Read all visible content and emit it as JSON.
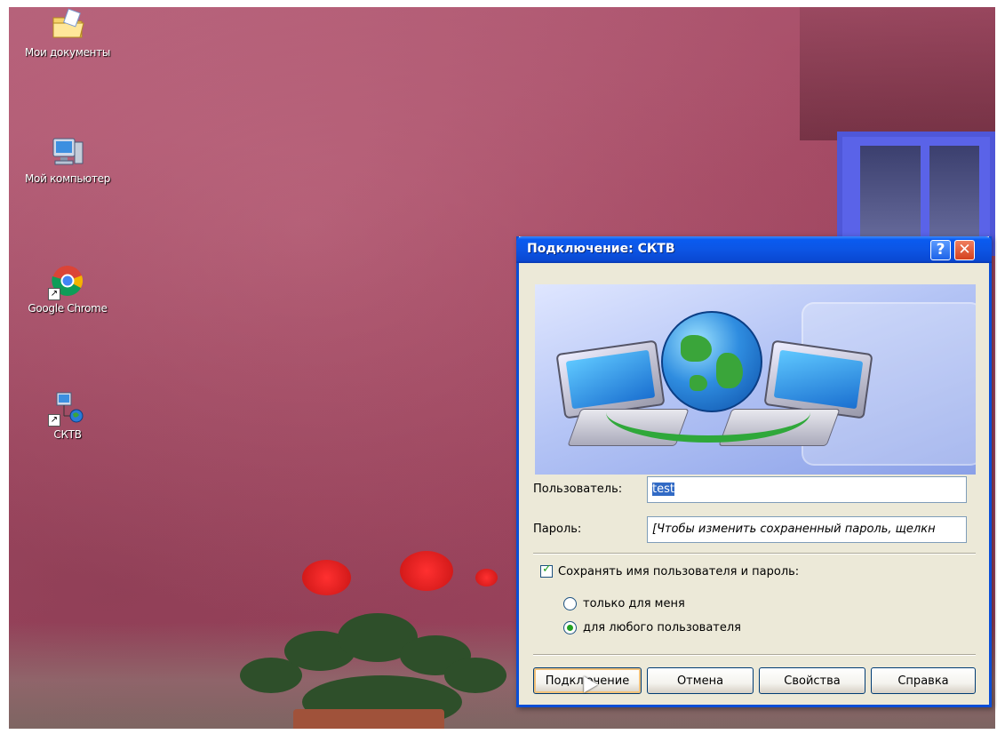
{
  "desktop": {
    "icons": [
      {
        "label": "Мои документы",
        "icon": "my-documents-folder-icon"
      },
      {
        "label": "Мой компьютер",
        "icon": "my-computer-icon"
      },
      {
        "label": "Google Chrome",
        "icon": "google-chrome-icon"
      },
      {
        "label": "СКТВ",
        "icon": "network-connection-icon"
      }
    ]
  },
  "dialog": {
    "title": "Подключение: СКТВ",
    "help_button": "?",
    "close_button": "✕",
    "user_label": "Пользователь:",
    "user_value": "test",
    "password_label": "Пароль:",
    "password_value": "[Чтобы изменить сохраненный пароль, щелкн",
    "save_checkbox": {
      "label": "Сохранять имя пользователя и пароль:",
      "checked": true
    },
    "radio_options": [
      {
        "label": "только для меня",
        "selected": false
      },
      {
        "label": "для любого пользователя",
        "selected": true
      }
    ],
    "buttons": {
      "connect": "Подключение",
      "cancel": "Отмена",
      "properties": "Свойства",
      "help": "Справка"
    }
  },
  "colors": {
    "titlebar": "#0a5bf0",
    "dialog_bg": "#ece9d8",
    "desktop_wall": "#a64c66",
    "check_green": "#21a121"
  }
}
